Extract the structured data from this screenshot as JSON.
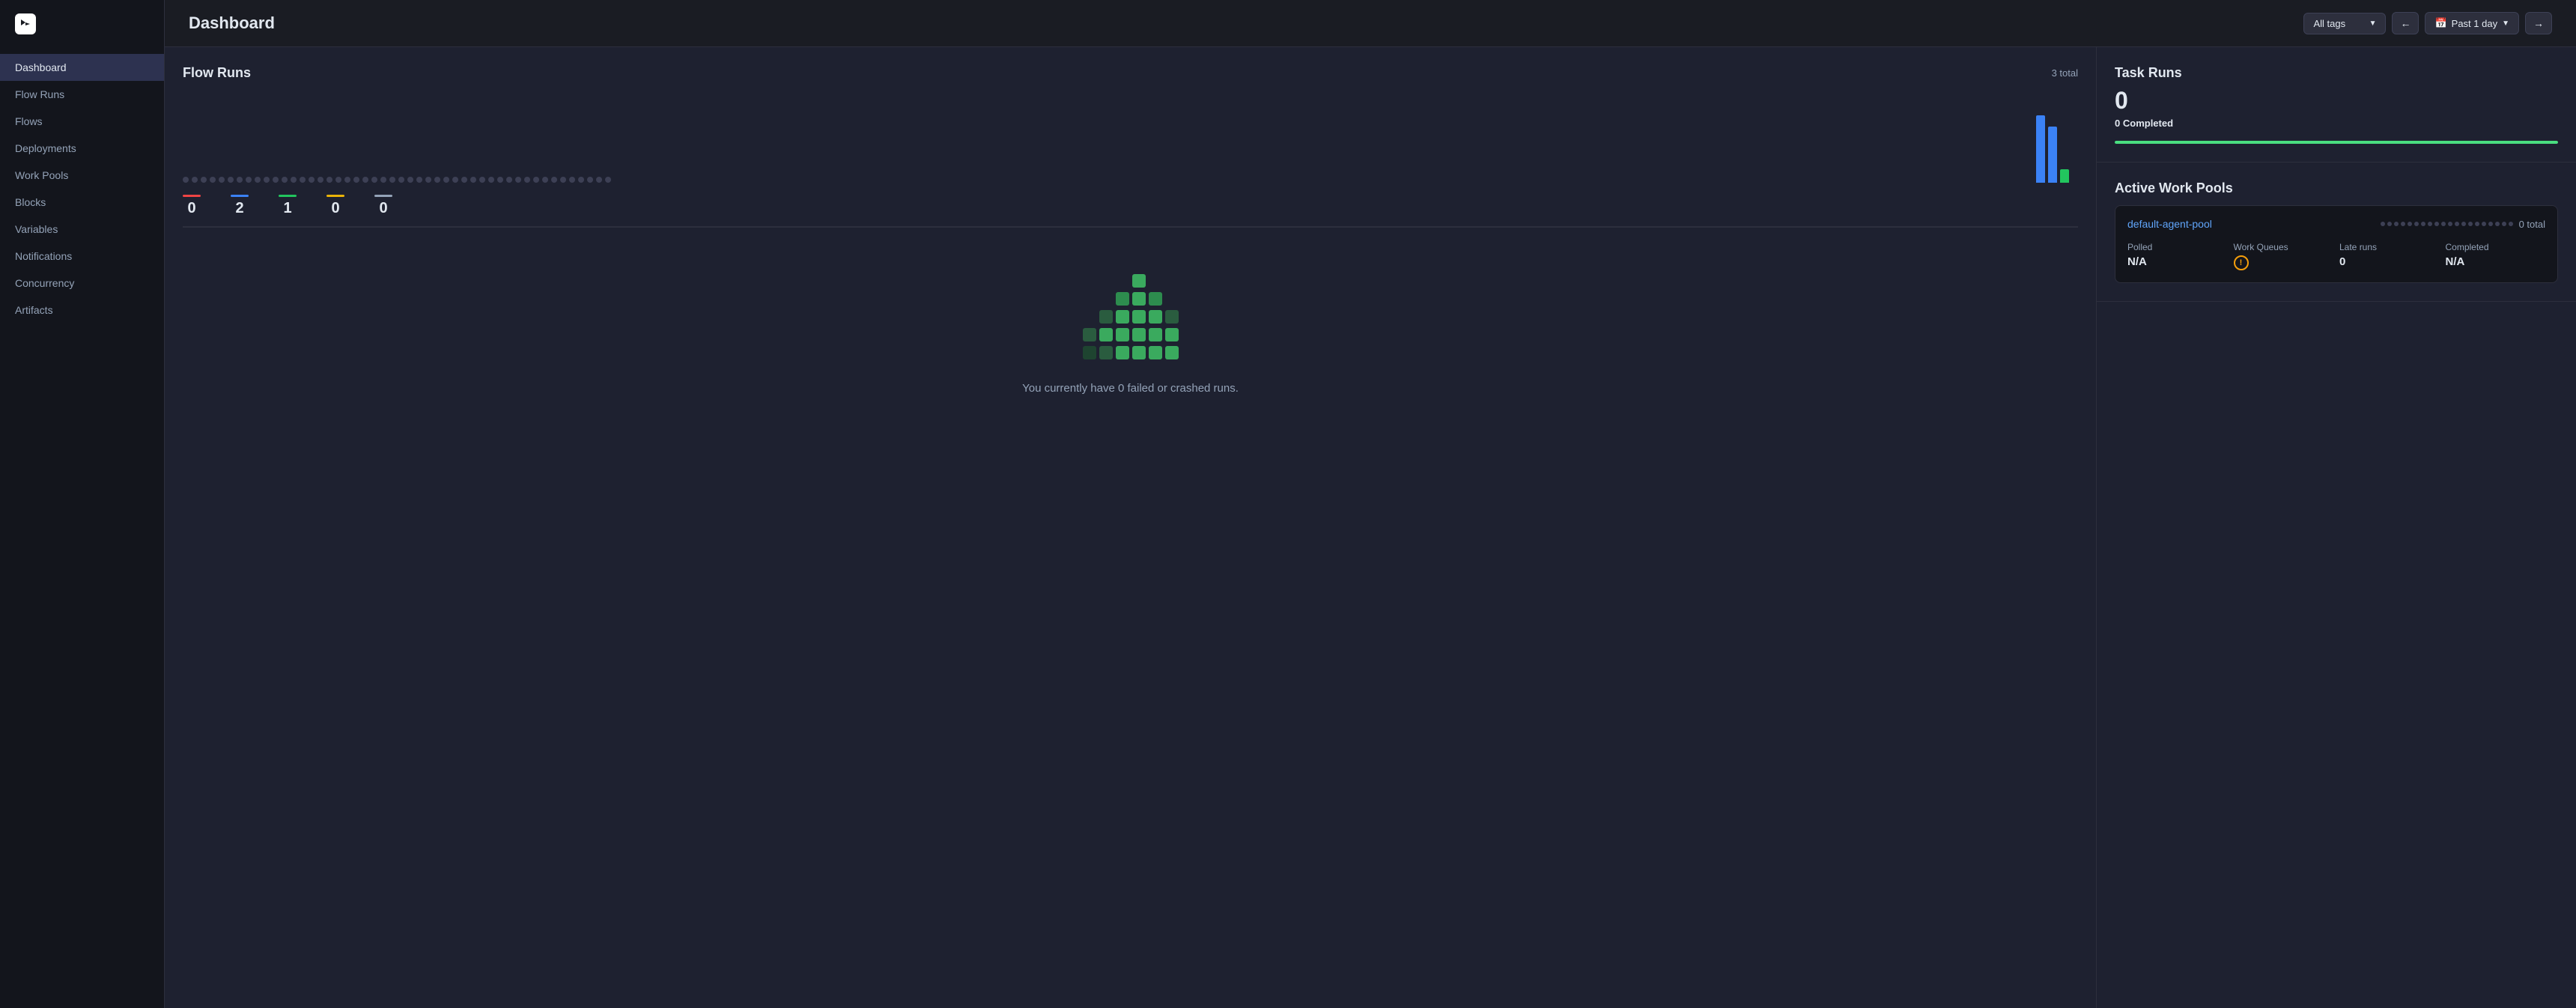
{
  "app": {
    "logo_text": "P"
  },
  "sidebar": {
    "items": [
      {
        "label": "Dashboard",
        "active": true
      },
      {
        "label": "Flow Runs",
        "active": false
      },
      {
        "label": "Flows",
        "active": false
      },
      {
        "label": "Deployments",
        "active": false
      },
      {
        "label": "Work Pools",
        "active": false
      },
      {
        "label": "Blocks",
        "active": false
      },
      {
        "label": "Variables",
        "active": false
      },
      {
        "label": "Notifications",
        "active": false
      },
      {
        "label": "Concurrency",
        "active": false
      },
      {
        "label": "Artifacts",
        "active": false
      }
    ]
  },
  "header": {
    "title": "Dashboard",
    "tags_label": "All tags",
    "time_label": "Past 1 day"
  },
  "flow_runs": {
    "title": "Flow Runs",
    "total_label": "3 total",
    "stats": [
      {
        "color": "#ef4444",
        "value": "0"
      },
      {
        "color": "#3b82f6",
        "value": "2"
      },
      {
        "color": "#22c55e",
        "value": "1"
      },
      {
        "color": "#eab308",
        "value": "0"
      },
      {
        "color": "#94a3b8",
        "value": "0"
      }
    ],
    "empty_message": "You currently have 0 failed or crashed runs."
  },
  "task_runs": {
    "title": "Task Runs",
    "count": "0",
    "completed_label": "Completed",
    "completed_count": "0"
  },
  "work_pools": {
    "title": "Active Work Pools",
    "pool": {
      "name": "default-agent-pool",
      "total_label": "0 total",
      "polled_label": "Polled",
      "polled_value": "N/A",
      "queues_label": "Work Queues",
      "late_label": "Late runs",
      "late_value": "0",
      "completed_label": "Completed",
      "completed_value": "N/A"
    }
  }
}
